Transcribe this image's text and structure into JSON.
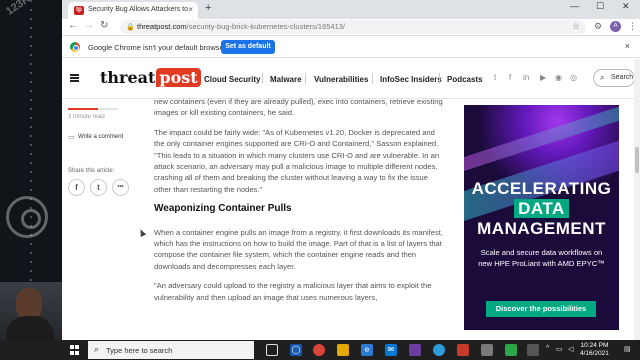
{
  "browser": {
    "tab_title": "Security Bug Allows Attackers to",
    "tab_close": "×",
    "new_tab": "+",
    "url_host": "threatpost.com",
    "url_path": "/security-bug-brick-kubernetes-clusters/165413/",
    "win_min": "—",
    "win_max": "☐",
    "win_close": "✕"
  },
  "infobar": {
    "message": "Google Chrome isn't your default browser",
    "button": "Set as default",
    "close": "×"
  },
  "site": {
    "logo_a": "threat",
    "logo_b": "post",
    "nav": [
      "Cloud Security",
      "Malware",
      "Vulnerabilities",
      "InfoSec Insiders",
      "Podcasts"
    ],
    "search_label": "Search"
  },
  "share": {
    "read_time": "3 minute read",
    "write_comment": "Write a comment",
    "share_label": "Share this article:",
    "progress": 0.6,
    "buttons": [
      "f",
      "t",
      "•••"
    ]
  },
  "article": {
    "p1": "new containers (even if they are already pulled), exec into containers, retrieve existing images or kill existing containers, he said.",
    "p2": "The impact could be fairly wide: \"As of Kubernetes v1.20, Docker is deprecated and the only container engines supported are CRI-O and Containerd,\" Sasson explained. \"This leads to a situation in which many clusters use CRI-O and are vulnerable. In an attack scenario, an adversary may pull a malicious image to multiple different nodes, crashing all of them and breaking the cluster without leaving a way to fix the issue other than restarting the nodes.\"",
    "heading": "Weaponizing Container Pulls",
    "p3": "When a container engine pulls an image from a registry, it first downloads its manifest, which has the instructions on how to build the image. Part of that is a list of layers that compose the container file system, which the container engine reads and then downloads and decompresses each layer.",
    "p4": "\"An adversary could upload to the registry a malicious layer that aims to exploit the vulnerability and then upload an image that uses numerous layers,"
  },
  "ad": {
    "line1": "ACCELERATING",
    "line2": "DATA",
    "line3": "MANAGEMENT",
    "subtext": "Scale and secure data workflows on new HPE ProLiant with AMD EPYC™",
    "cta": "Discover the possibilities",
    "accent": "#01a982",
    "bg": "#1b0b3a"
  },
  "taskbar": {
    "search_placeholder": "Type here to search",
    "time": "10:24 PM",
    "date": "4/16/2021"
  },
  "desktop": {
    "watermark": "123RF"
  }
}
